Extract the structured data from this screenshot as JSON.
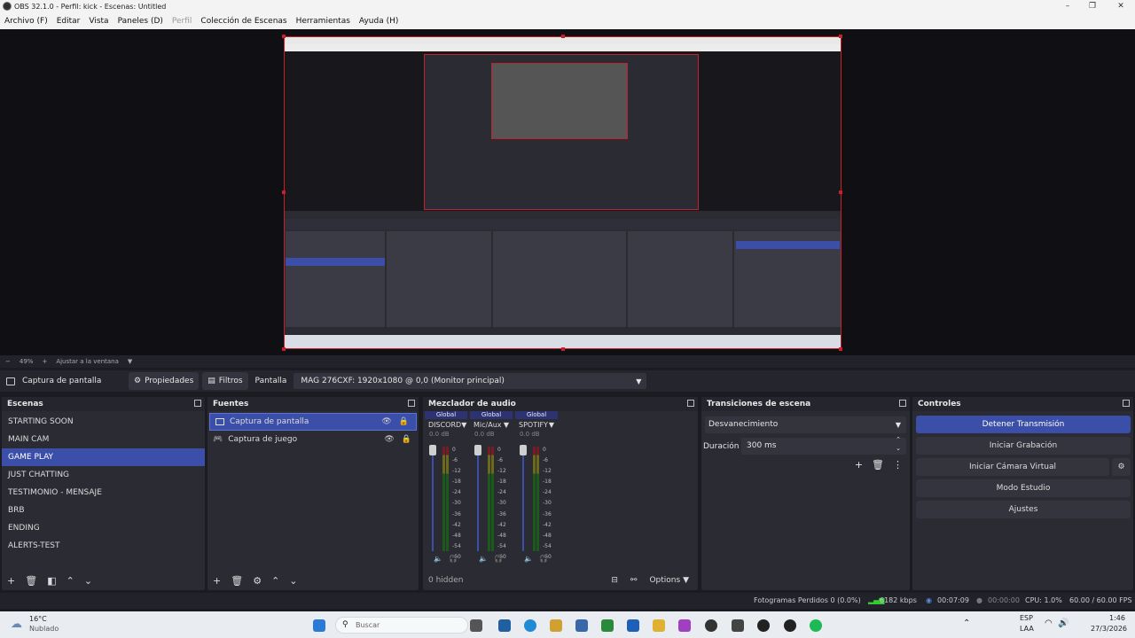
{
  "window": {
    "title": "OBS 32.1.0 - Perfil: kick - Escenas: Untitled",
    "minimize": "–",
    "maximize": "❐",
    "close": "✕"
  },
  "menu": [
    "Archivo (F)",
    "Editar",
    "Vista",
    "Paneles (D)",
    "Perfil",
    "Colección de Escenas",
    "Herramientas",
    "Ayuda (H)"
  ],
  "zoom": {
    "minus": "−",
    "value": "49%",
    "plus": "+",
    "fit": "Ajustar a la ventana",
    "caret": "▼"
  },
  "source_toolbar": {
    "source_name": "Captura de pantalla",
    "properties": "Propiedades",
    "filters": "Filtros",
    "display_label": "Pantalla",
    "display_value": "MAG 276CXF: 1920x1080 @ 0,0 (Monitor principal)"
  },
  "scenes": {
    "title": "Escenas",
    "items": [
      "STARTING SOON",
      "MAIN CAM",
      "GAME PLAY",
      "JUST CHATTING",
      "TESTIMONIO - MENSAJE",
      "BRB",
      "ENDING",
      "ALERTS-TEST"
    ],
    "selected_index": 2
  },
  "sources": {
    "title": "Fuentes",
    "items": [
      "Captura de pantalla",
      "Captura de juego"
    ]
  },
  "mixer": {
    "title": "Mezclador de audio",
    "channels": [
      {
        "scope": "Global",
        "name": "DISCORD",
        "db": "0.0 dB"
      },
      {
        "scope": "Global",
        "name": "Mic/Aux",
        "db": "0.0 dB"
      },
      {
        "scope": "Global",
        "name": "SPOTIFY",
        "db": "0.0 dB"
      }
    ],
    "ticks": [
      "0",
      "-6",
      "-12",
      "-18",
      "-24",
      "-30",
      "-36",
      "-42",
      "-48",
      "-54",
      "-60"
    ],
    "hidden": "0 hidden",
    "options": "Options"
  },
  "transitions": {
    "title": "Transiciones de escena",
    "selected": "Desvanecimiento",
    "duration_label": "Duración",
    "duration_value": "300 ms"
  },
  "controls": {
    "title": "Controles",
    "stop_stream": "Detener Transmisión",
    "start_record": "Iniciar Grabación",
    "virtual_cam": "Iniciar Cámara Virtual",
    "studio_mode": "Modo Estudio",
    "settings": "Ajustes"
  },
  "status": {
    "dropped": "Fotogramas Perdidos 0 (0.0%)",
    "bitrate": "6182 kbps",
    "stream_time": "00:07:09",
    "record_time": "00:00:00",
    "cpu": "CPU: 1.0%",
    "fps": "60.00 / 60.00 FPS"
  },
  "taskbar": {
    "weather_temp": "16°C",
    "weather_desc": "Nublado",
    "search": "Buscar",
    "lang": "ESP",
    "lang2": "LAA",
    "time": "1:46",
    "date": "27/3/2026"
  },
  "colors": {
    "accent": "#3b4ea8",
    "selection_border": "#c8202a",
    "panel_bg": "#2a2b33"
  }
}
